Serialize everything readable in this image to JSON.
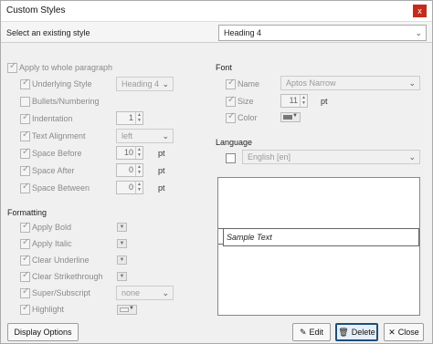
{
  "window": {
    "title": "Custom Styles",
    "close_glyph": "x"
  },
  "selector": {
    "label": "Select an existing style",
    "value": "Heading 4"
  },
  "paragraph": {
    "apply_whole": "Apply to whole paragraph",
    "rows": [
      {
        "label": "Underlying Style",
        "value": "Heading 4"
      },
      {
        "label": "Bullets/Numbering"
      },
      {
        "label": "Indentation",
        "value": "1"
      },
      {
        "label": "Text Alignment",
        "value": "left"
      },
      {
        "label": "Space Before",
        "value": "10",
        "unit": "pt"
      },
      {
        "label": "Space After",
        "value": "0",
        "unit": "pt"
      },
      {
        "label": "Space Between",
        "value": "0",
        "unit": "pt"
      }
    ]
  },
  "formatting": {
    "title": "Formatting",
    "rows": [
      {
        "label": "Apply Bold"
      },
      {
        "label": "Apply Italic"
      },
      {
        "label": "Clear Underline"
      },
      {
        "label": "Clear Strikethrough"
      },
      {
        "label": "Super/Subscript",
        "value": "none"
      },
      {
        "label": "Highlight"
      }
    ]
  },
  "font": {
    "title": "Font",
    "name_label": "Name",
    "name_value": "Aptos Narrow",
    "size_label": "Size",
    "size_value": "11",
    "size_unit": "pt",
    "color_label": "Color",
    "color_swatch": "#777777"
  },
  "language": {
    "title": "Language",
    "value": "English [en]"
  },
  "preview": {
    "text": "Sample Text"
  },
  "buttons": {
    "display_options": "Display Options",
    "edit": "Edit",
    "delete": "Delete",
    "close": "Close"
  },
  "icons": {
    "chevron": "chevron-down-icon",
    "edit": "edit-icon",
    "delete": "trash-icon",
    "close": "close-icon"
  }
}
